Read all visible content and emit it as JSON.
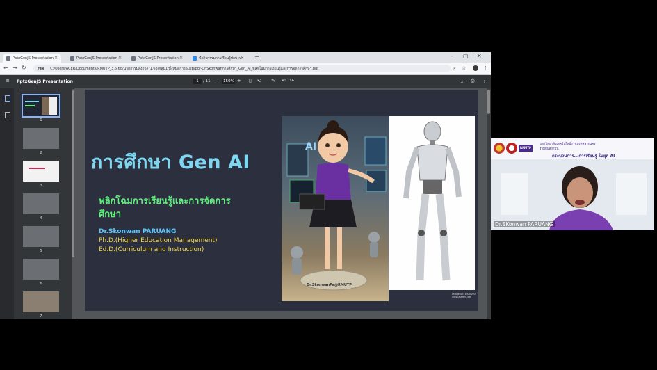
{
  "browser": {
    "tabs": [
      {
        "label": "PptxGenJS Presentation",
        "active": true
      },
      {
        "label": "PptxGenJS Presentation",
        "active": false
      },
      {
        "label": "PptxGenJS Presentation",
        "active": false
      },
      {
        "label": "นำกิจกรรมการเรียนรู้ทักษะทาง",
        "active": false
      }
    ],
    "address": {
      "scheme": "File",
      "url": "C:/Users/ACER/Documents/RMUTP_3.6.68/นวัตกรรมสิ่ง267/1.68/กลุ่ม1/ทั้งหมดการอบรม/pdf-Dr.Skonwanการศึกษา_Gen_AI_พลิกโฉมการเรียนรู้และการจัดการศึกษา.pdf"
    }
  },
  "pdf": {
    "title": "PptxGenJS Presentation",
    "page_current": "1",
    "page_total": "/ 11",
    "zoom": "150%",
    "thumbnails": [
      {
        "num": "1"
      },
      {
        "num": "2"
      },
      {
        "num": "3"
      },
      {
        "num": "4"
      },
      {
        "num": "5"
      },
      {
        "num": "6"
      },
      {
        "num": "7"
      }
    ]
  },
  "slide": {
    "title": "การศึกษา Gen AI",
    "subtitle": "พลิกโฉมการเรียนรู้และการจัดการศึกษา",
    "author": "Dr.Skonwan PARUANG",
    "phd": "Ph.D.(Higher Education Management)",
    "edd": "Ed.D.(Curriculum and Instruction)",
    "image_label": "Dr.SkonwanPa@RMUTP",
    "screen_text": "AI",
    "caption": "Image ID: 1000000 www.alamy.com"
  },
  "webcam": {
    "participant_name": "Dr.SKonwan PARUANG",
    "banner_logo": "RMUTP",
    "banner_line1": "มหาวิทยาลัยเทคโนโลยีราชมงคลพระนคร",
    "banner_line2": "ร่วมกับสถาบัน",
    "banner_line3": "กระบวนการ...การเรียนรู้ ในยุค AI"
  },
  "colors": {
    "slide_bg": "#2b2f3e",
    "title": "#7fd6f0",
    "subtitle": "#5cf27a",
    "author": "#5bc8ff",
    "degree": "#f7d94a"
  }
}
